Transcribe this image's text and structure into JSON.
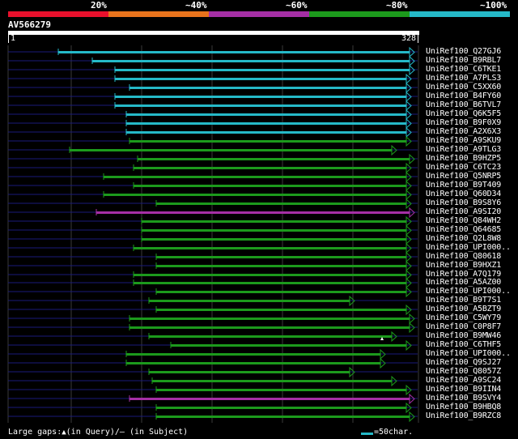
{
  "colors": {
    "bg": "#000000",
    "band_red": "#e8102c",
    "band_orange": "#e8731c",
    "band_purple": "#a52fa5",
    "band_green": "#1c9a1c",
    "band_cyan": "#25b9c8",
    "dark_line": "#1a1a7a",
    "grid": "#3a3a3a"
  },
  "identity_scale": [
    {
      "label": "20%",
      "color": "#e8102c"
    },
    {
      "label": "~40%",
      "color": "#e8731c"
    },
    {
      "label": "~60%",
      "color": "#a52fa5"
    },
    {
      "label": "~80%",
      "color": "#1c9a1c"
    },
    {
      "label": "~100%",
      "color": "#25b9c8"
    }
  ],
  "query": {
    "name": "AV566279",
    "start": "1",
    "end": "328",
    "length": 328
  },
  "hits": [
    {
      "name": "UniRef100_Q27GJ6",
      "start": 72,
      "end": 512,
      "color": "cyan"
    },
    {
      "name": "UniRef100_B9RBL7",
      "start": 114,
      "end": 512,
      "color": "cyan"
    },
    {
      "name": "UniRef100_C6TKE1",
      "start": 142,
      "end": 512,
      "color": "cyan"
    },
    {
      "name": "UniRef100_A7PLS3",
      "start": 142,
      "end": 508,
      "color": "cyan"
    },
    {
      "name": "UniRef100_C5XX60",
      "start": 160,
      "end": 508,
      "color": "cyan"
    },
    {
      "name": "UniRef100_B4FY60",
      "start": 142,
      "end": 508,
      "color": "cyan"
    },
    {
      "name": "UniRef100_B6TVL7",
      "start": 142,
      "end": 508,
      "color": "cyan"
    },
    {
      "name": "UniRef100_Q6K5F5",
      "start": 156,
      "end": 508,
      "color": "cyan"
    },
    {
      "name": "UniRef100_B9F0X9",
      "start": 156,
      "end": 508,
      "color": "cyan"
    },
    {
      "name": "UniRef100_A2X6X3",
      "start": 156,
      "end": 508,
      "color": "cyan"
    },
    {
      "name": "UniRef100_A9SKU9",
      "start": 160,
      "end": 508,
      "color": "green"
    },
    {
      "name": "UniRef100_A9TLG3",
      "start": 86,
      "end": 490,
      "color": "green"
    },
    {
      "name": "UniRef100_B9HZP5",
      "start": 170,
      "end": 512,
      "color": "green"
    },
    {
      "name": "UniRef100_C6TC23",
      "start": 165,
      "end": 508,
      "color": "green"
    },
    {
      "name": "UniRef100_Q5NRP5",
      "start": 128,
      "end": 508,
      "color": "green"
    },
    {
      "name": "UniRef100_B9T409",
      "start": 165,
      "end": 508,
      "color": "green"
    },
    {
      "name": "UniRef100_Q60D34",
      "start": 128,
      "end": 508,
      "color": "green"
    },
    {
      "name": "UniRef100_B9S8Y6",
      "start": 193,
      "end": 508,
      "color": "green"
    },
    {
      "name": "UniRef100_A9SI20",
      "start": 119,
      "end": 512,
      "color": "purple"
    },
    {
      "name": "UniRef100_Q84WH2",
      "start": 175,
      "end": 508,
      "color": "green"
    },
    {
      "name": "UniRef100_Q64685",
      "start": 175,
      "end": 508,
      "color": "green"
    },
    {
      "name": "UniRef100_Q2L8W8",
      "start": 175,
      "end": 508,
      "color": "green"
    },
    {
      "name": "UniRef100_UPI000..",
      "start": 165,
      "end": 508,
      "color": "green"
    },
    {
      "name": "UniRef100_Q80618",
      "start": 193,
      "end": 508,
      "color": "green"
    },
    {
      "name": "UniRef100_B9HXZ1",
      "start": 193,
      "end": 508,
      "color": "green"
    },
    {
      "name": "UniRef100_A7Q179",
      "start": 165,
      "end": 508,
      "color": "green"
    },
    {
      "name": "UniRef100_A5AZ00",
      "start": 165,
      "end": 508,
      "color": "green"
    },
    {
      "name": "UniRef100_UPI000..",
      "start": 193,
      "end": 508,
      "color": "green"
    },
    {
      "name": "UniRef100_B9T7S1",
      "start": 184,
      "end": 438,
      "color": "green"
    },
    {
      "name": "UniRef100_A5BZT9",
      "start": 193,
      "end": 508,
      "color": "green"
    },
    {
      "name": "UniRef100_C5WY79",
      "start": 160,
      "end": 512,
      "color": "green"
    },
    {
      "name": "UniRef100_C0P8F7",
      "start": 160,
      "end": 512,
      "color": "green"
    },
    {
      "name": "UniRef100_B9MW46",
      "start": 184,
      "end": 490,
      "color": "green",
      "gap_mark": 472
    },
    {
      "name": "UniRef100_C6THF5",
      "start": 211,
      "end": 508,
      "color": "green"
    },
    {
      "name": "UniRef100_UPI000..",
      "start": 156,
      "end": 476,
      "color": "green"
    },
    {
      "name": "UniRef100_Q9SJ27",
      "start": 156,
      "end": 476,
      "color": "green"
    },
    {
      "name": "UniRef100_Q8057Z",
      "start": 184,
      "end": 438,
      "color": "green"
    },
    {
      "name": "UniRef100_A9SC24",
      "start": 188,
      "end": 490,
      "color": "green"
    },
    {
      "name": "UniRef100_B9IIN4",
      "start": 193,
      "end": 508,
      "color": "green"
    },
    {
      "name": "UniRef100_B9SVY4",
      "start": 160,
      "end": 512,
      "color": "purple"
    },
    {
      "name": "UniRef100_B9HBQ8",
      "start": 193,
      "end": 508,
      "color": "green"
    },
    {
      "name": "UniRef100_B9RZC8",
      "start": 193,
      "end": 512,
      "color": "green"
    }
  ],
  "footer": {
    "gaps_label": "Large gaps:",
    "in_query": "(in Query)/",
    "dash": "—",
    "in_subject": " (in Subject)",
    "scale_label": "=50char."
  }
}
